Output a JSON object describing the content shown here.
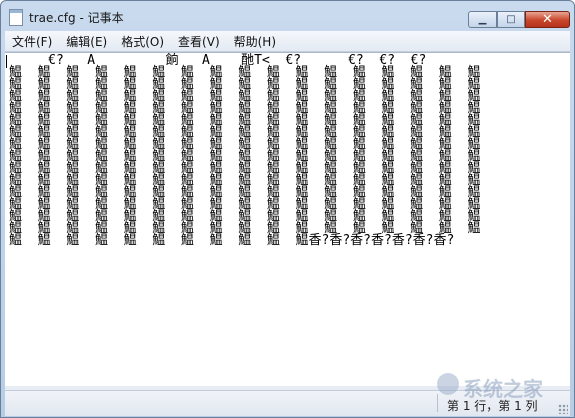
{
  "window": {
    "title": "trae.cfg - 记事本",
    "controls": {
      "minimize": "▁",
      "maximize": "□",
      "close": "✕"
    }
  },
  "menu": {
    "items": [
      {
        "label": "文件(F)"
      },
      {
        "label": "编辑(E)"
      },
      {
        "label": "格式(O)"
      },
      {
        "label": "查看(V)"
      },
      {
        "label": "帮助(H)"
      }
    ]
  },
  "editor": {
    "lines": [
      "     €?   A         餉   A    酏T<  €?      €?  €?  €?",
      "鰛  鰛  鰛  鰛  鰛  鰛  鰛  鰛  鰛  鰛  鰛  鰛  鰛  鰛  鰛  鰛  鰛",
      "鰛  鰛  鰛  鰛  鰛  鰛  鰛  鰛  鰛  鰛  鰛  鰛  鰛  鰛  鰛  鰛  鰛",
      "鰛  鰛  鰛  鰛  鰛  鰛  鰛  鰛  鰛  鰛  鰛  鰛  鰛  鰛  鰛  鰛  鰛",
      "鰛  鰛  鰛  鰛  鰛  鰛  鰛  鰛  鰛  鰛  鰛  鰛  鰛  鰛  鰛  鰛  鰛",
      "鰛  鰛  鰛  鰛  鰛  鰛  鰛  鰛  鰛  鰛  鰛  鰛  鰛  鰛  鰛  鰛  鰛",
      "鰛  鰛  鰛  鰛  鰛  鰛  鰛  鰛  鰛  鰛  鰛  鰛  鰛  鰛  鰛  鰛  鰛",
      "鰛  鰛  鰛  鰛  鰛  鰛  鰛  鰛  鰛  鰛  鰛  鰛  鰛  鰛  鰛  鰛  鰛",
      "鰛  鰛  鰛  鰛  鰛  鰛  鰛  鰛  鰛  鰛  鰛  鰛  鰛  鰛  鰛  鰛  鰛",
      "鰛  鰛  鰛  鰛  鰛  鰛  鰛  鰛  鰛  鰛  鰛  鰛  鰛  鰛  鰛  鰛  鰛",
      "鰛  鰛  鰛  鰛  鰛  鰛  鰛  鰛  鰛  鰛  鰛  鰛  鰛  鰛  鰛  鰛  鰛",
      "鰛  鰛  鰛  鰛  鰛  鰛  鰛  鰛  鰛  鰛  鰛  鰛  鰛  鰛  鰛  鰛  鰛",
      "鰛  鰛  鰛  鰛  鰛  鰛  鰛  鰛  鰛  鰛  鰛  鰛  鰛  鰛  鰛  鰛  鰛",
      "鰛  鰛  鰛  鰛  鰛  鰛  鰛  鰛  鰛  鰛  鰛  鰛  鰛  鰛  鰛  鰛  鰛",
      "鰛  鰛  鰛  鰛  鰛  鰛  鰛  鰛  鰛  鰛  鰛  鰛  鰛  鰛  鰛  鰛  鰛",
      "鰛  鰛  鰛  鰛  鰛  鰛  鰛  鰛  鰛  鰛  鰛香?香?香?香?香?香?香?"
    ]
  },
  "status": {
    "position": "第 1 行，第 1 列"
  },
  "watermark": {
    "text": "系统之家"
  }
}
